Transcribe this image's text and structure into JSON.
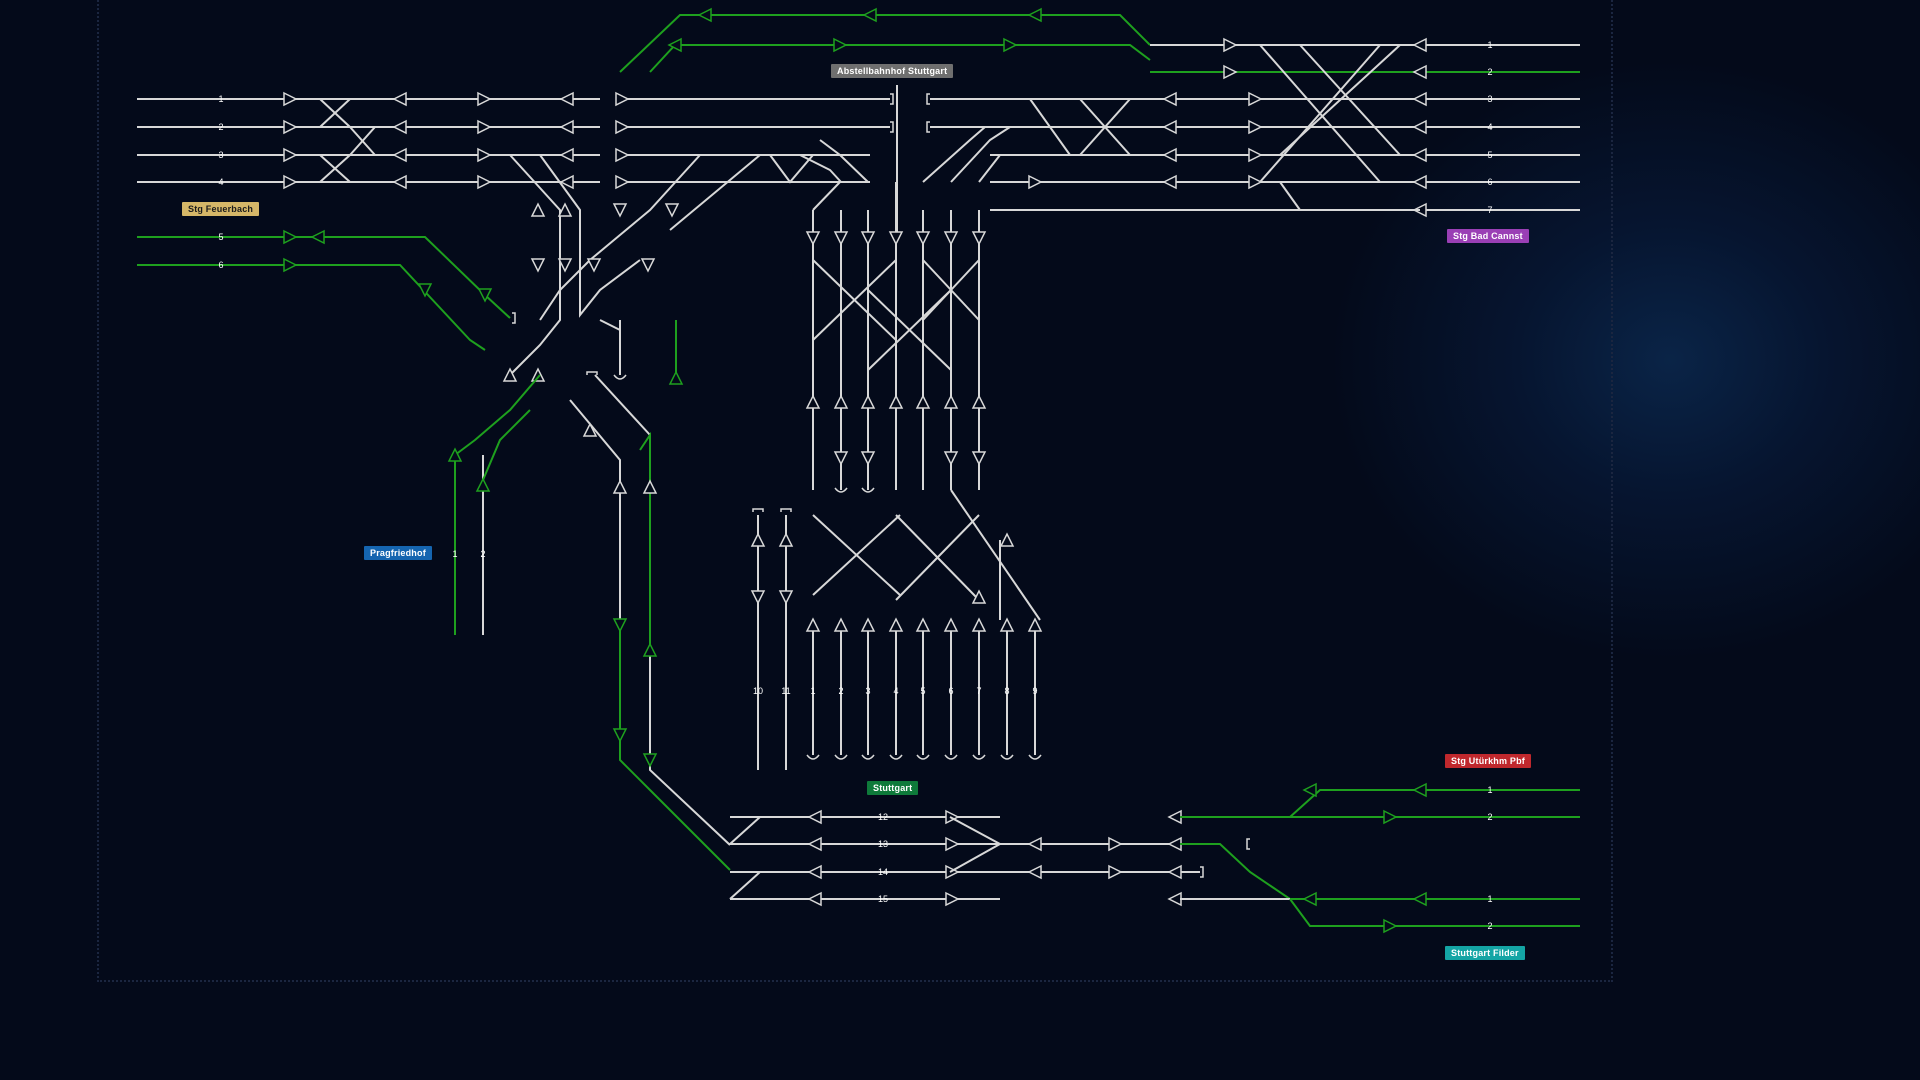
{
  "colors": {
    "background": "#040a1a",
    "track": "#d8d8d8",
    "route_active": "#1ea01e"
  },
  "stations": {
    "feuerbach": {
      "label": "Stg Feuerbach",
      "color": "#d6b768",
      "text_color": "#1c1c1c"
    },
    "abstell": {
      "label": "Abstellbahnhof Stuttgart",
      "color": "#6f6f6f",
      "text_color": "#ffffff"
    },
    "bad_cannstatt": {
      "label": "Stg Bad Cannst",
      "color": "#9a3fb5",
      "text_color": "#ffffff"
    },
    "pragfriedhof": {
      "label": "Pragfriedhof",
      "color": "#1565b0",
      "text_color": "#ffffff"
    },
    "stuttgart": {
      "label": "Stuttgart",
      "color": "#0e7a3a",
      "text_color": "#ffffff"
    },
    "untertuerkheim": {
      "label": "Stg Utürkhm Pbf",
      "color": "#c0282d",
      "text_color": "#ffffff"
    },
    "filder": {
      "label": "Stuttgart Filder",
      "color": "#14a5a5",
      "text_color": "#ffffff"
    }
  },
  "track_numbers": {
    "feuerbach": [
      "1",
      "2",
      "3",
      "4",
      "5",
      "6"
    ],
    "bad_cannstatt": [
      "1",
      "2",
      "3",
      "4",
      "5",
      "6",
      "7"
    ],
    "pragfriedhof": [
      "1",
      "2"
    ],
    "platforms": [
      "10",
      "11",
      "1",
      "2",
      "3",
      "4",
      "5",
      "6",
      "7",
      "8",
      "9"
    ],
    "lower_tracks": [
      "12",
      "13",
      "14",
      "15"
    ],
    "untertuerkheim": [
      "1",
      "2"
    ],
    "filder": [
      "1",
      "2"
    ]
  },
  "active_routes": [
    "Feuerbach track 5",
    "Feuerbach track 6",
    "Upper loop to Bad Cannstatt tracks 1-2",
    "Pragfriedhof track 1",
    "Lower curve to Stuttgart platforms",
    "Untertürkheim tracks 1-2",
    "Filder tracks 1-2"
  ]
}
